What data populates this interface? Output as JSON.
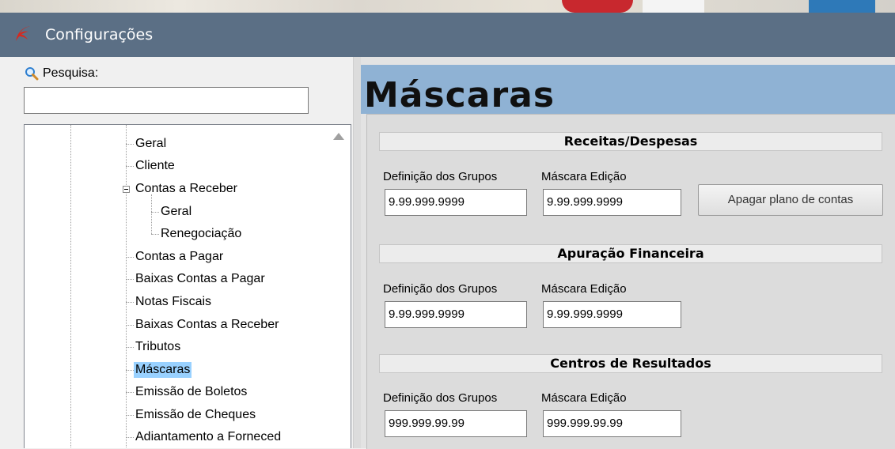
{
  "window": {
    "title": "Configurações"
  },
  "search": {
    "label": "Pesquisa:",
    "value": ""
  },
  "tree": {
    "items": [
      {
        "label": "Geral"
      },
      {
        "label": "Cliente"
      },
      {
        "label": "Contas a Receber"
      },
      {
        "label": "Geral"
      },
      {
        "label": "Renegociação"
      },
      {
        "label": "Contas a Pagar"
      },
      {
        "label": "Baixas Contas a Pagar"
      },
      {
        "label": "Notas Fiscais"
      },
      {
        "label": "Baixas Contas a Receber"
      },
      {
        "label": "Tributos"
      },
      {
        "label": "Máscaras"
      },
      {
        "label": "Emissão de Boletos"
      },
      {
        "label": "Emissão de Cheques"
      },
      {
        "label": "Adiantamento a Forneced"
      }
    ],
    "selected": "Máscaras"
  },
  "page": {
    "title": "Máscaras"
  },
  "sections": [
    {
      "title": "Receitas/Despesas",
      "group_label": "Definição dos Grupos",
      "mask_label": "Máscara Edição",
      "group_value": "9.99.999.9999",
      "mask_value": "9.99.999.9999",
      "button_label": "Apagar plano de contas"
    },
    {
      "title": "Apuração Financeira",
      "group_label": "Definição dos Grupos",
      "mask_label": "Máscara Edição",
      "group_value": "9.99.999.9999",
      "mask_value": "9.99.999.9999"
    },
    {
      "title": "Centros de Resultados",
      "group_label": "Definição dos Grupos",
      "mask_label": "Máscara Edição",
      "group_value": "999.999.99.99",
      "mask_value": "999.999.99.99"
    }
  ],
  "colors": {
    "titlebar": "#5b6f85",
    "header_band": "#8fb2d4",
    "selection": "#99d1ff"
  }
}
